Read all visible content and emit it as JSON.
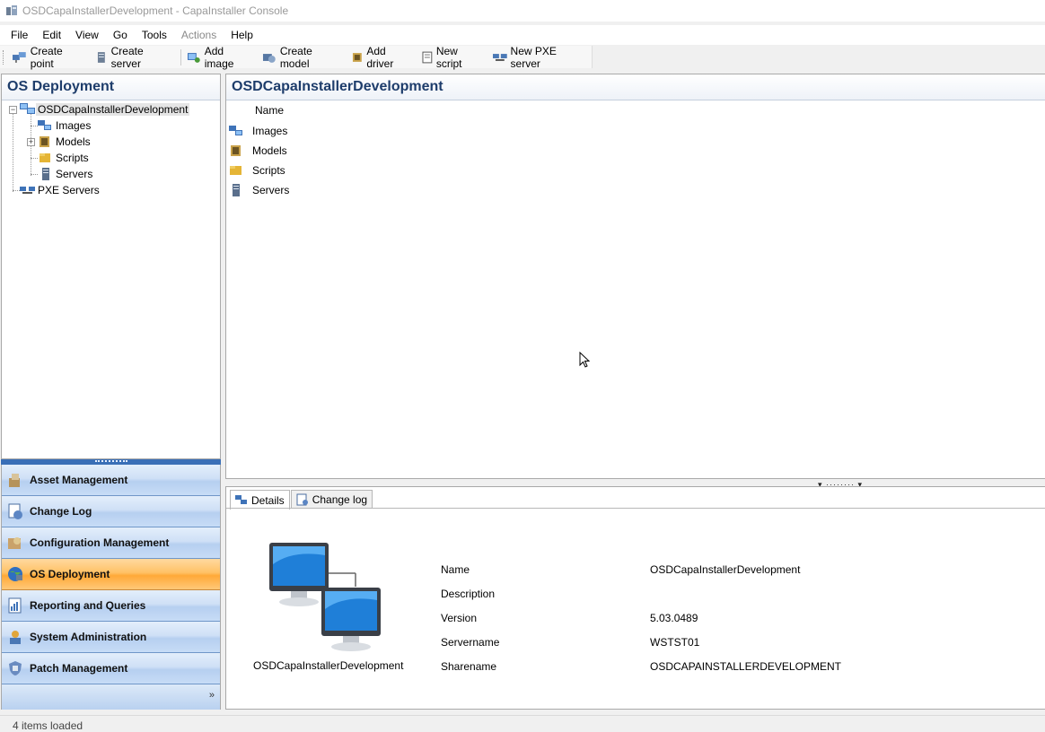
{
  "window": {
    "title": "OSDCapaInstallerDevelopment - CapaInstaller Console"
  },
  "menu": {
    "items": [
      {
        "label": "File",
        "disabled": false
      },
      {
        "label": "Edit",
        "disabled": false
      },
      {
        "label": "View",
        "disabled": false
      },
      {
        "label": "Go",
        "disabled": false
      },
      {
        "label": "Tools",
        "disabled": false
      },
      {
        "label": "Actions",
        "disabled": true
      },
      {
        "label": "Help",
        "disabled": false
      }
    ]
  },
  "toolbar": {
    "create_point": "Create point",
    "create_server": "Create server",
    "add_image": "Add image",
    "create_model": "Create model",
    "add_driver": "Add driver",
    "new_script": "New script",
    "new_pxe_server": "New PXE server"
  },
  "left_panel": {
    "title": "OS Deployment",
    "tree": {
      "root": "OSDCapaInstallerDevelopment",
      "children": [
        "Images",
        "Models",
        "Scripts",
        "Servers"
      ],
      "pxe": "PXE Servers"
    }
  },
  "nav": {
    "items": [
      {
        "label": "Asset Management",
        "active": false,
        "icon": "asset-icon"
      },
      {
        "label": "Change Log",
        "active": false,
        "icon": "changelog-icon"
      },
      {
        "label": "Configuration Management",
        "active": false,
        "icon": "config-icon"
      },
      {
        "label": "OS Deployment",
        "active": true,
        "icon": "globe-icon"
      },
      {
        "label": "Reporting and Queries",
        "active": false,
        "icon": "report-icon"
      },
      {
        "label": "System Administration",
        "active": false,
        "icon": "admin-icon"
      },
      {
        "label": "Patch Management",
        "active": false,
        "icon": "patch-icon"
      }
    ]
  },
  "right_panel": {
    "title": "OSDCapaInstallerDevelopment",
    "column_name": "Name",
    "rows": [
      "Images",
      "Models",
      "Scripts",
      "Servers"
    ]
  },
  "details": {
    "tabs": [
      "Details",
      "Change log"
    ],
    "caption": "OSDCapaInstallerDevelopment",
    "labels": {
      "name": "Name",
      "description": "Description",
      "version": "Version",
      "servername": "Servername",
      "sharename": "Sharename"
    },
    "values": {
      "name": "OSDCapaInstallerDevelopment",
      "description": "",
      "version": "5.03.0489",
      "servername": "WSTST01",
      "sharename": "OSDCAPAINSTALLERDEVELOPMENT"
    }
  },
  "status": {
    "text": "4 items loaded"
  },
  "colors": {
    "header_text": "#1e3d6b",
    "nav_active": "#ffc266",
    "nav_normal": "#cfe0f6",
    "splitter": "#3a6fb7"
  }
}
